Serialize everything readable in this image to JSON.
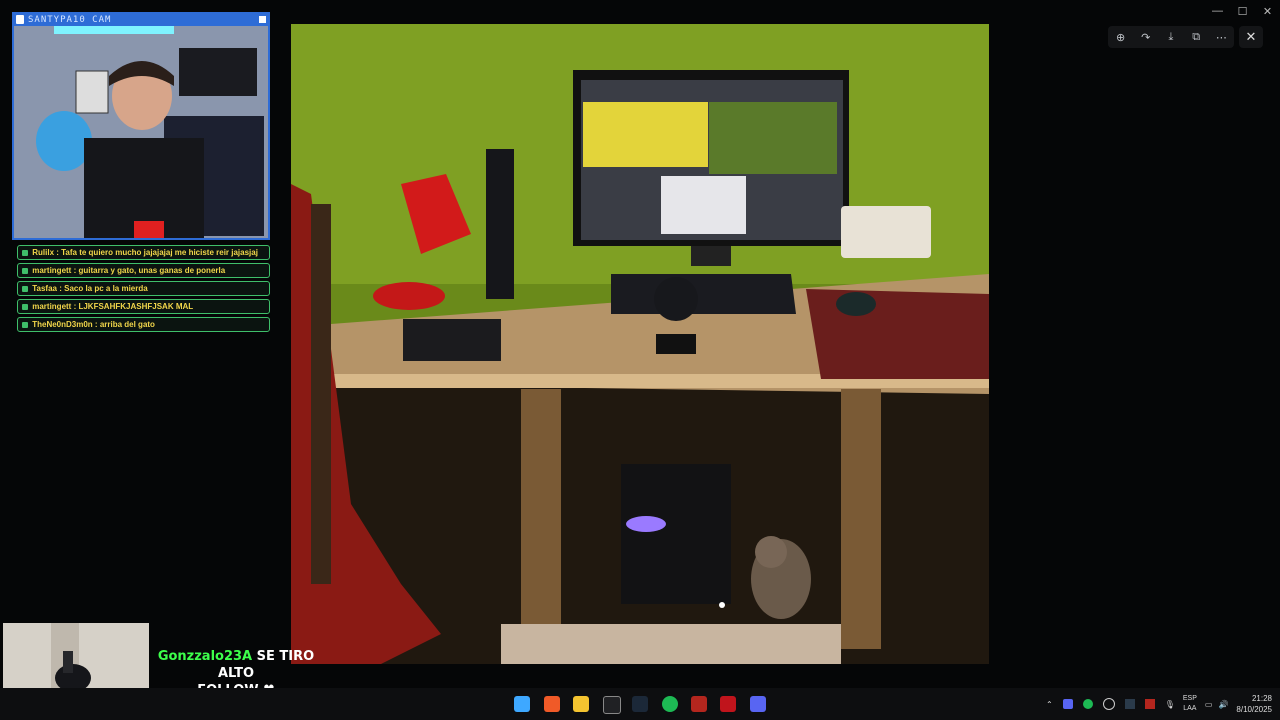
{
  "window": {
    "minimize": "—",
    "maximize": "☐",
    "close": "✕"
  },
  "cam": {
    "title": "SANTYPA10 CAM"
  },
  "chat": [
    {
      "user": "Rulilx",
      "text": " : Tafa te quiero mucho jajajajaj me hiciste reir jajasjaj",
      "color": "#f3d14a"
    },
    {
      "user": "martingett",
      "text": " : guitarra y gato, unas ganas de ponerla",
      "color": "#f3d14a"
    },
    {
      "user": "Tasfaa",
      "text": " : Saco la pc a la mierda",
      "color": "#f3d14a"
    },
    {
      "user": "martingett",
      "text": " : LJKFSAHFKJASHFJSAK MAL",
      "color": "#f3d14a"
    },
    {
      "user": "TheNe0nD3m0n",
      "text": " : arriba del gato",
      "color": "#f3d14a"
    }
  ],
  "viewer": {
    "icons": [
      "zoom-in-icon",
      "rotate-icon",
      "download-icon",
      "open-external-icon",
      "more-icon"
    ],
    "close": "✕"
  },
  "follow_alert": {
    "name": "Gonzzalo23A",
    "action": " SE TIRO ALTO",
    "line2": "FOLLOW ♥"
  },
  "taskbar": {
    "lang": "ESP",
    "region": "LAA",
    "time": "21:28",
    "date": "8/10/2025"
  },
  "colors": {
    "accent": "#2e6cd6",
    "chat_border": "#3fbf6a",
    "follow_name": "#3dff4b"
  }
}
